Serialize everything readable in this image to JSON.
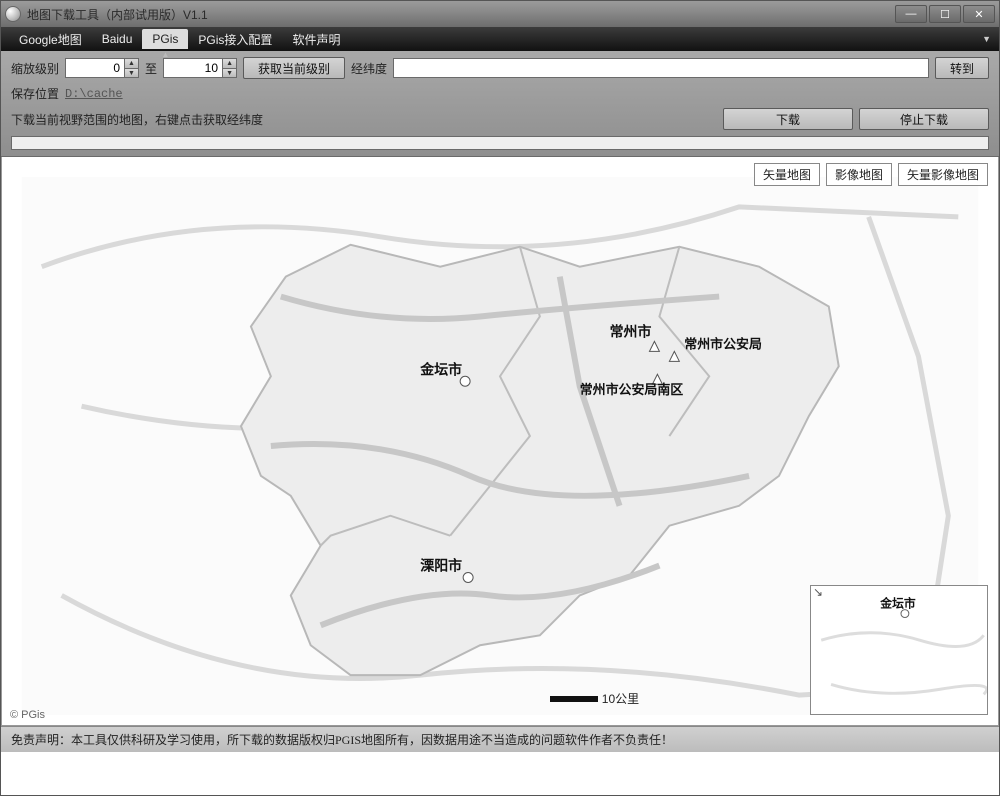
{
  "window": {
    "title": "地图下载工具（内部试用版）V1.1"
  },
  "menu": {
    "items": [
      "Google地图",
      "Baidu",
      "PGis",
      "PGis接入配置",
      "软件声明"
    ],
    "active_index": 2
  },
  "toolbar": {
    "zoom_label": "缩放级别",
    "zoom_from": "0",
    "sep": "至",
    "zoom_to": "10",
    "get_level_btn": "获取当前级别",
    "coords_label": "经纬度",
    "coords_value": "",
    "goto_btn": "转到",
    "save_label": "保存位置",
    "save_path": "D:\\cache",
    "hint": "下载当前视野范围的地图，右键点击获取经纬度",
    "download_btn": "下载",
    "stop_btn": "停止下载"
  },
  "map": {
    "type_buttons": [
      "矢量地图",
      "影像地图",
      "矢量影像地图"
    ],
    "labels": {
      "changzhou": "常州市",
      "changzhou_psb": "常州市公安局",
      "changzhou_psb_south": "常州市公安局南区",
      "jintan": "金坛市",
      "liyang": "溧阳市"
    },
    "scale_text": "10公里",
    "attribution": "© PGis",
    "minimap_label": "金坛市"
  },
  "footer": {
    "disclaimer": "免责声明：本工具仅供科研及学习使用，所下载的数据版权归PGIS地图所有，因数据用途不当造成的问题软件作者不负责任！"
  }
}
